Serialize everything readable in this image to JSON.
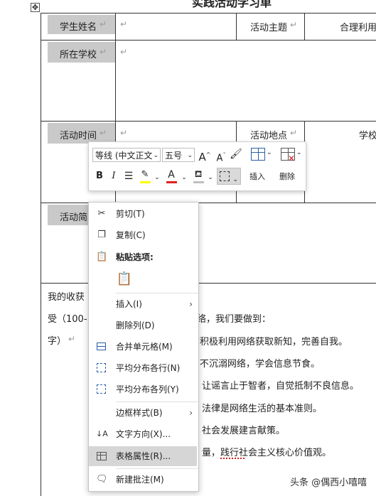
{
  "document": {
    "top_title_partial": "实践活动学习单",
    "move_handle_icon": "move-handle-icon",
    "table": {
      "student_name_label": "学生姓名",
      "activity_theme_label": "活动主题",
      "theme_value_partial": "合理利用",
      "school_label": "所在学校",
      "activity_time_label": "活动时间",
      "activity_place_label": "活动地点",
      "place_value_partial": "学校",
      "activity_intro_label_partial": "活动简",
      "gains_label_line1": "我的收获",
      "gains_label_line2": "受（100-",
      "gains_label_line3": "字）",
      "return_mark": "↵",
      "gains_lines": [
        "络，我们要做到：",
        "积极利用网络获取新知，完善自我。",
        "不沉溺网络，学会信息节食。",
        "让谣言止于智者，自觉抵制不良信息。",
        "法律是网络生活的基本准则。",
        "社会发展建言献策。",
        "量，践行社会主义核心价值观。"
      ]
    }
  },
  "mini_toolbar": {
    "font_name": "等线 (中文正文",
    "font_size": "五号",
    "grow_font": "A",
    "shrink_font": "A",
    "format_painter_icon": "format-painter-icon",
    "bold": "B",
    "italic": "I",
    "align_icon": "align-center-icon",
    "highlight_icon": "highlighter-icon",
    "font_color_glyph": "A",
    "shading_icon": "shading-bucket-icon",
    "borders_icon": "borders-icon",
    "insert_label": "插入",
    "delete_label": "删除",
    "colors": {
      "highlight": "#ffff00",
      "font_color": "#e02020"
    }
  },
  "context_menu": {
    "items": [
      {
        "label": "剪切(T)",
        "icon": "scissors-icon"
      },
      {
        "label": "复制(C)",
        "icon": "copy-icon"
      },
      {
        "label": "粘贴选项:",
        "icon": "paste-icon"
      },
      {
        "label": "",
        "icon": "paste-keep-formatting-icon"
      },
      {
        "label": "插入(I)",
        "icon": "",
        "submenu": true
      },
      {
        "label": "删除列(D)",
        "icon": ""
      },
      {
        "label": "合并单元格(M)",
        "icon": "merge-cells-icon"
      },
      {
        "label": "平均分布各行(N)",
        "icon": "distribute-rows-icon"
      },
      {
        "label": "平均分布各列(Y)",
        "icon": "distribute-columns-icon"
      },
      {
        "label": "边框样式(B)",
        "icon": "",
        "submenu": true
      },
      {
        "label": "文字方向(X)...",
        "icon": "text-direction-icon"
      },
      {
        "label": "表格属性(R)...",
        "icon": "table-properties-icon",
        "highlighted": true
      },
      {
        "label": "新建批注(M)",
        "icon": "new-comment-icon"
      }
    ]
  },
  "watermark": {
    "text": "头条 @偶西小嘻嘻"
  }
}
